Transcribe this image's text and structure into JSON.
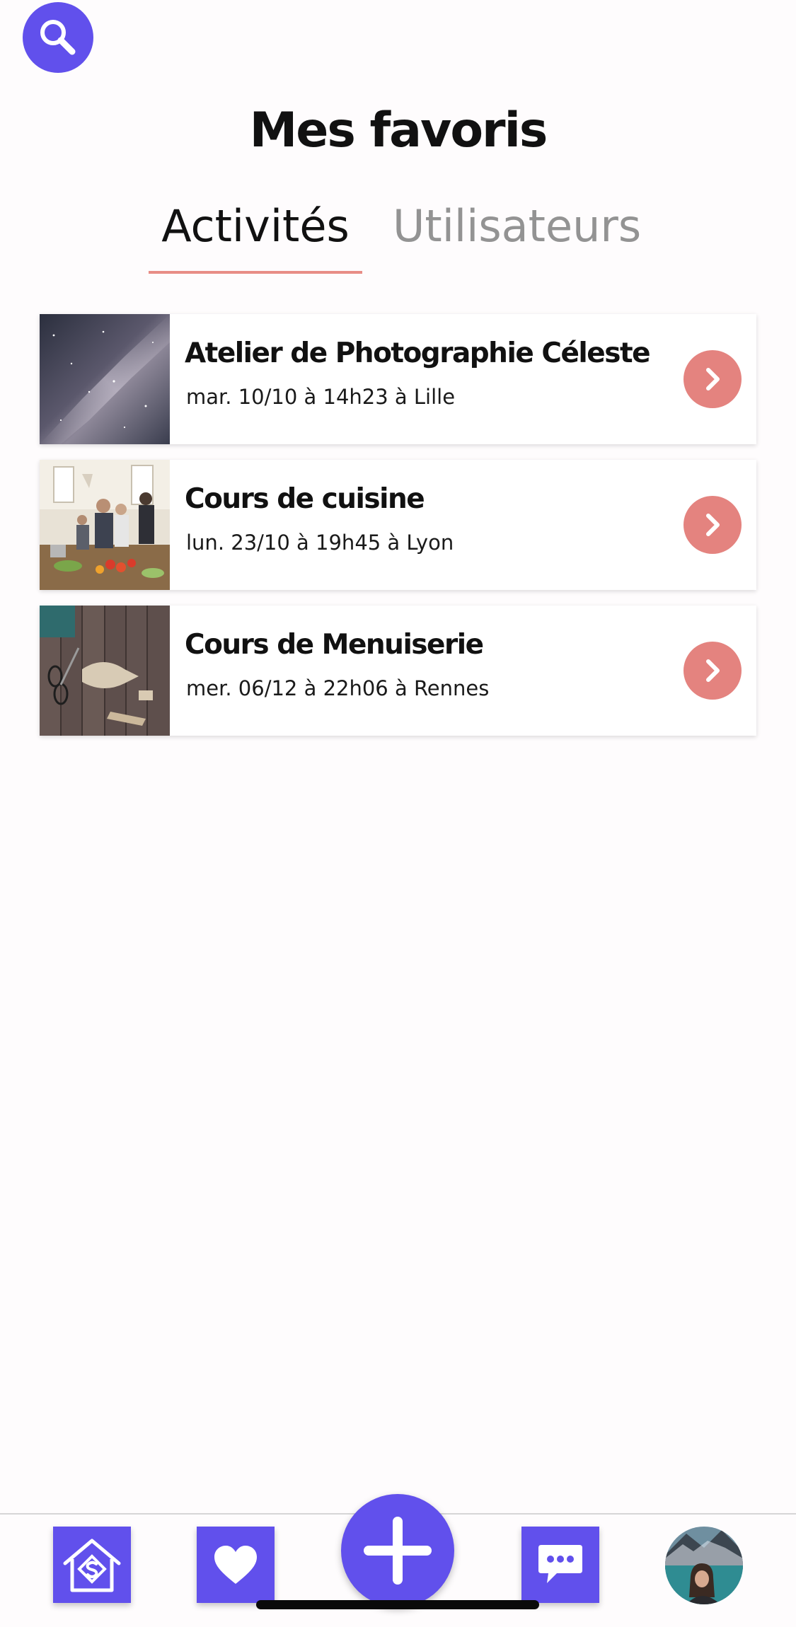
{
  "header": {
    "title": "Mes favoris",
    "search_icon": "search-icon"
  },
  "tabs": [
    {
      "label": "Activités",
      "active": true
    },
    {
      "label": "Utilisateurs",
      "active": false
    }
  ],
  "activities": [
    {
      "title": "Atelier de Photographie Céleste",
      "subtitle": "mar. 10/10 à 14h23 à Lille",
      "thumb": "milky-way-photo"
    },
    {
      "title": "Cours de cuisine",
      "subtitle": "lun. 23/10 à 19h45 à Lyon",
      "thumb": "cooking-class-photo"
    },
    {
      "title": "Cours de Menuiserie",
      "subtitle": "mer. 06/12 à 22h06 à Rennes",
      "thumb": "woodworking-photo"
    }
  ],
  "bottom_nav": {
    "items": [
      "home-icon",
      "heart-icon",
      "plus-icon",
      "chat-icon",
      "avatar"
    ]
  },
  "colors": {
    "accent": "#6150ec",
    "arrow": "#e4837f",
    "tab_underline": "#e88d86",
    "inactive_tab": "#939393"
  }
}
